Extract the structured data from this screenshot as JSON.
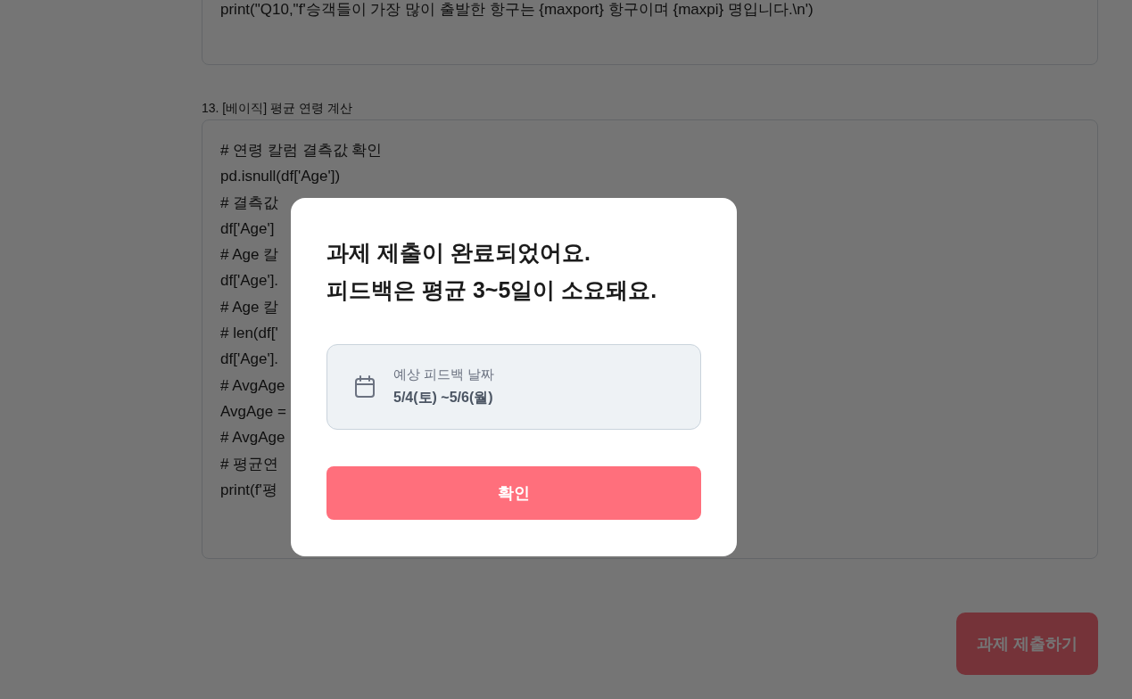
{
  "previous_answer": {
    "code_line": "print(\"Q10,\"f'승객들이 가장 많이 출발한 항구는 {maxport} 항구이며 {maxpi} 명입니다.\\n')"
  },
  "question": {
    "label": "13. [베이직] 평균 연령 계산",
    "code_lines": [
      "# 연령 칼럼 결측값 확인",
      "pd.isnull(df['Age'])",
      "# 결측값",
      "df['Age']",
      "# Age 칼",
      "df['Age'].",
      "# Age 칼",
      "# len(df['",
      "df['Age'].",
      "# AvgAge",
      "AvgAge =",
      "# AvgAge",
      "# 평균연",
      "print(f'평"
    ]
  },
  "submit_button": "과제 제출하기",
  "modal": {
    "title_lines": [
      "과제 제출이 완료되었어요.",
      "피드백은 평균 3~5일이 소요돼요."
    ],
    "info": {
      "label": "예상 피드백 날짜",
      "value": "5/4(토) ~5/6(월)"
    },
    "confirm_button": "확인"
  }
}
